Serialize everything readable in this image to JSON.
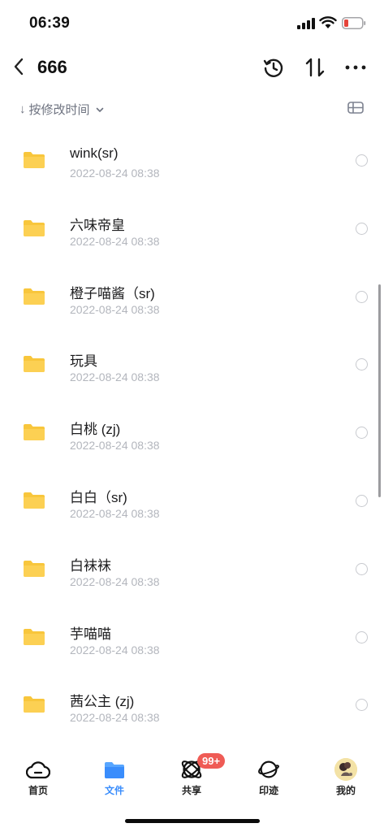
{
  "status_bar": {
    "time": "06:39",
    "battery_color": "#e5443b"
  },
  "header": {
    "title": "666",
    "icons": [
      "back-icon",
      "history-icon",
      "sort-icon",
      "more-icon"
    ]
  },
  "sort": {
    "label": "按修改时间",
    "arrow": "↓",
    "icon": "chevron-down-icon",
    "view_icon": "list-view-icon"
  },
  "files": [
    {
      "name": "wink(sr)",
      "date": "2022-08-24 08:38"
    },
    {
      "name": "六味帝皇",
      "date": "2022-08-24 08:38"
    },
    {
      "name": "橙子喵酱（sr)",
      "date": "2022-08-24 08:38"
    },
    {
      "name": "玩具",
      "date": "2022-08-24 08:38"
    },
    {
      "name": "白桃 (zj)",
      "date": "2022-08-24 08:38"
    },
    {
      "name": "白白（sr)",
      "date": "2022-08-24 08:38"
    },
    {
      "name": "白袜袜",
      "date": "2022-08-24 08:38"
    },
    {
      "name": "芋喵喵",
      "date": "2022-08-24 08:38"
    },
    {
      "name": "茜公主 (zj)",
      "date": "2022-08-24 08:38"
    }
  ],
  "tabs": [
    {
      "label": "首页",
      "icon": "home-cloud-icon",
      "active": false
    },
    {
      "label": "文件",
      "icon": "folder-icon",
      "active": true
    },
    {
      "label": "共享",
      "icon": "share-orbit-icon",
      "active": false,
      "badge": "99+"
    },
    {
      "label": "印迹",
      "icon": "planet-icon",
      "active": false
    },
    {
      "label": "我的",
      "icon": "avatar-icon",
      "active": false
    }
  ],
  "colors": {
    "folder": "#fcd053",
    "active_tab": "#3a8dfc",
    "badge": "#ef5b55",
    "date_text": "#b3b6bd"
  }
}
